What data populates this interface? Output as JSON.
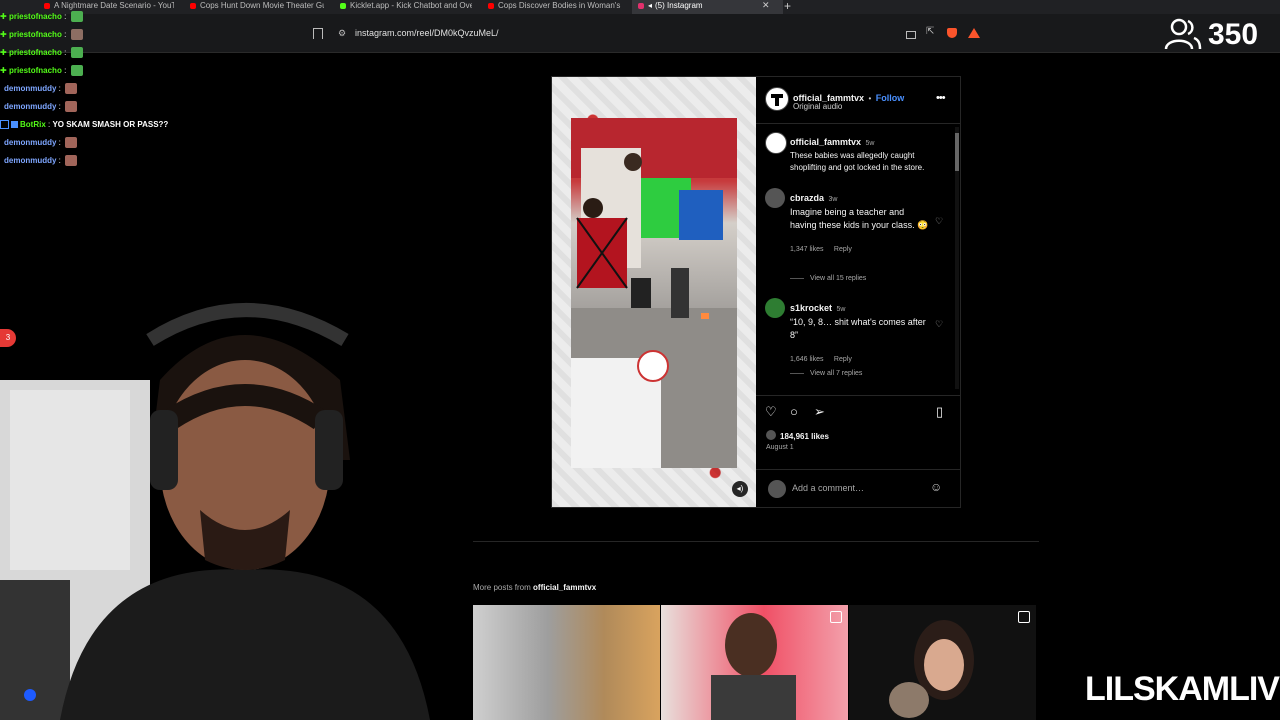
{
  "browser": {
    "tabs": [
      {
        "label": "A Nightmare Date Scenario - YouTube",
        "color": "#ff0000"
      },
      {
        "label": "Cops Hunt Down Movie Theater Gunman",
        "color": "#ff0000"
      },
      {
        "label": "Kicklet.app - Kick Chatbot and Overlay",
        "color": "#53fc18"
      },
      {
        "label": "Cops Discover Bodies in Woman's Trunk",
        "color": "#ff0000"
      },
      {
        "label": "(5) Instagram",
        "color": "#e1306c",
        "active": true
      }
    ],
    "url": "instagram.com/reel/DM0kQvzuMeL/"
  },
  "chat": [
    {
      "user": "priestofnacho",
      "color": "#53fc18",
      "emote": "#4caf50"
    },
    {
      "user": "priestofnacho",
      "color": "#53fc18",
      "emote": "#8d6e63"
    },
    {
      "user": "priestofnacho",
      "color": "#53fc18",
      "emote": "#4caf50"
    },
    {
      "user": "priestofnacho",
      "color": "#53fc18",
      "emote": "#4caf50"
    },
    {
      "user": "demonmuddy",
      "color": "#7ea6ff",
      "emote": "#a1655a"
    },
    {
      "user": "demonmuddy",
      "color": "#7ea6ff",
      "emote": "#a1655a"
    },
    {
      "user": "BotRix",
      "color": "#53fc18",
      "message": "YO SKAM SMASH OR PASS??"
    },
    {
      "user": "demonmuddy",
      "color": "#7ea6ff",
      "emote": "#a1655a"
    },
    {
      "user": "demonmuddy",
      "color": "#7ea6ff",
      "emote": "#a1655a"
    }
  ],
  "side_notification": "3",
  "viewer_count": "350",
  "post": {
    "author": "official_fammtvx",
    "follow_label": "Follow",
    "audio": "Original audio",
    "caption": {
      "user": "official_fammtvx",
      "age": "5w",
      "text": "These babies was allegedly caught shoplifting and got locked in the store."
    },
    "comments": [
      {
        "user": "cbrazda",
        "age": "3w",
        "text": "Imagine being a teacher and having these kids in your class. 😳",
        "likes": "1,347 likes",
        "reply": "Reply",
        "view_replies": "View all 15 replies"
      },
      {
        "user": "s1krocket",
        "age": "5w",
        "text": "“10, 9, 8… shit what's comes after 8”",
        "likes": "1,646 likes",
        "reply": "Reply",
        "view_replies": "View all 7 replies"
      }
    ],
    "likes": "184,961 likes",
    "date": "August 1",
    "add_comment_placeholder": "Add a comment…"
  },
  "more_posts": {
    "prefix": "More posts from ",
    "user": "official_fammtvx"
  },
  "streamer_watermark": "LILSKAMLIVE"
}
